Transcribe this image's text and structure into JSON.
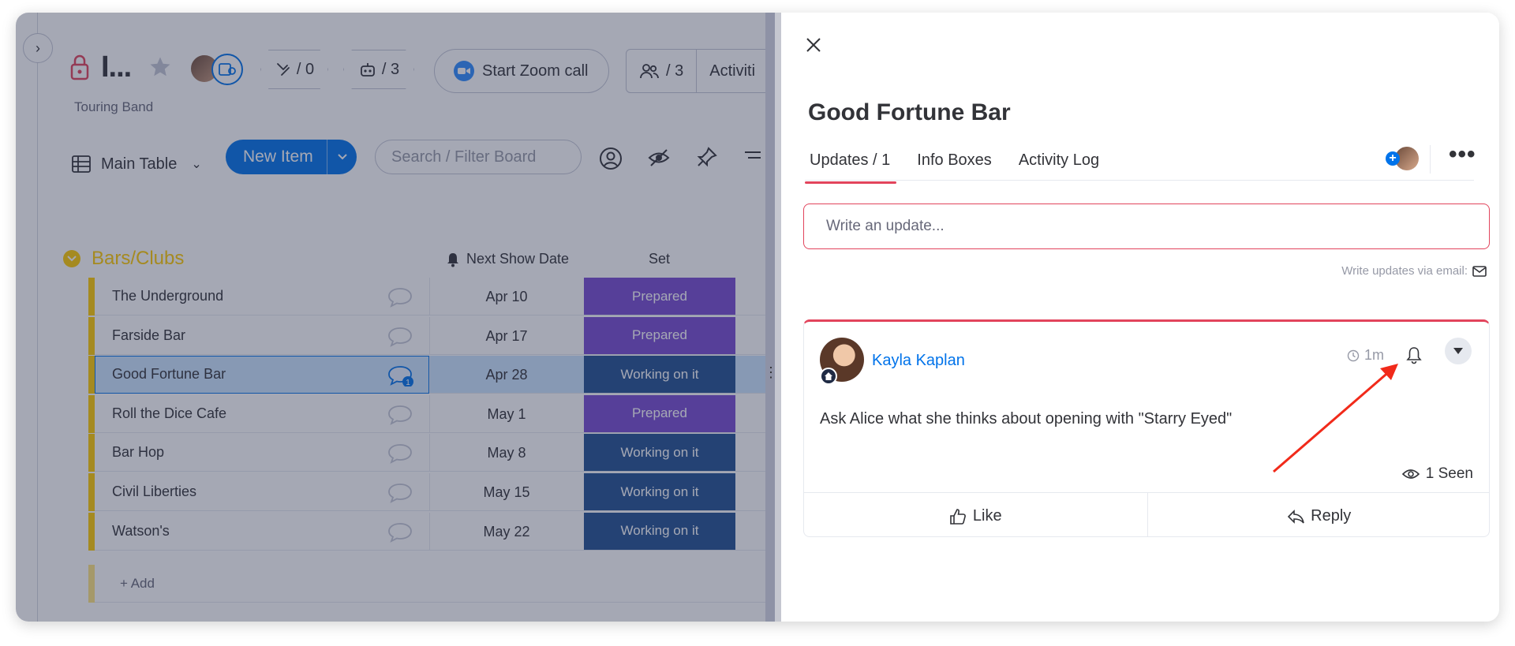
{
  "board": {
    "title": "I...",
    "subtitle": "Touring Band",
    "automations_count": "/ 0",
    "integrations_count": "/ 3",
    "zoom_label": "Start Zoom call",
    "people_count": "/ 3",
    "activity_label": "Activiti",
    "view_label": "Main Table",
    "new_item_label": "New Item",
    "search_placeholder": "Search / Filter Board",
    "group": {
      "title": "Bars/Clubs",
      "color": "#ffcb00",
      "columns": {
        "date": "Next Show Date",
        "set": "Set"
      },
      "rows": [
        {
          "name": "The Underground",
          "date": "Apr 10",
          "status": "Prepared",
          "status_color": "#784bd1"
        },
        {
          "name": "Farside Bar",
          "date": "Apr 17",
          "status": "Prepared",
          "status_color": "#784bd1"
        },
        {
          "name": "Good Fortune Bar",
          "date": "Apr 28",
          "status": "Working on it",
          "status_color": "#225091",
          "updates": "1",
          "selected": true
        },
        {
          "name": "Roll the Dice Cafe",
          "date": "May 1",
          "status": "Prepared",
          "status_color": "#784bd1"
        },
        {
          "name": "Bar Hop",
          "date": "May 8",
          "status": "Working on it",
          "status_color": "#225091"
        },
        {
          "name": "Civil Liberties",
          "date": "May 15",
          "status": "Working on it",
          "status_color": "#225091"
        },
        {
          "name": "Watson's",
          "date": "May 22",
          "status": "Working on it",
          "status_color": "#225091"
        }
      ],
      "add_label": "+ Add"
    }
  },
  "panel": {
    "item_title": "Good Fortune Bar",
    "tabs": [
      "Updates / 1",
      "Info Boxes",
      "Activity Log"
    ],
    "update_placeholder": "Write an update...",
    "email_hint": "Write updates via email:",
    "post": {
      "author": "Kayla Kaplan",
      "time": "1m",
      "body": "Ask Alice what she thinks about opening with \"Starry Eyed\"",
      "seen": "1 Seen",
      "like_label": "Like",
      "reply_label": "Reply"
    }
  },
  "colors": {
    "accent_blue": "#0073ea",
    "accent_red": "#e2445c",
    "annotation_arrow": "#f12a1a"
  }
}
